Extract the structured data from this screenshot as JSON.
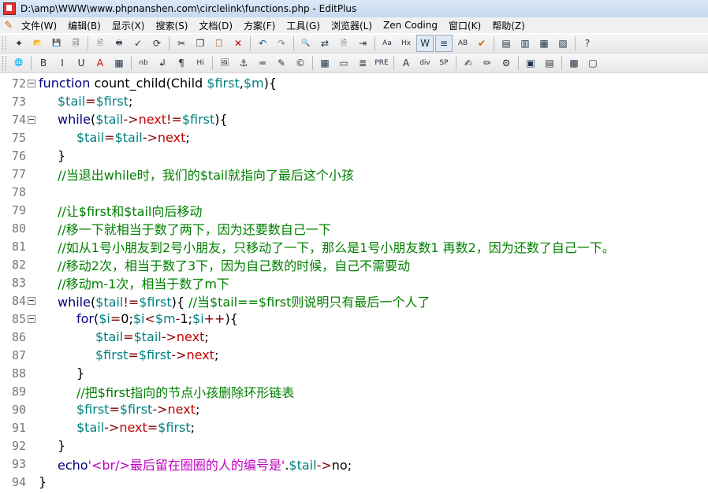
{
  "window": {
    "title": "D:\\amp\\WWW\\www.phpnanshen.com\\circlelink\\functions.php - EditPlus"
  },
  "menu": [
    "文件(W)",
    "编辑(B)",
    "显示(X)",
    "搜索(S)",
    "文档(D)",
    "方案(F)",
    "工具(G)",
    "浏览器(L)",
    "Zen Coding",
    "窗口(K)",
    "帮助(Z)"
  ],
  "toolbar1": [
    {
      "name": "new-file-icon",
      "glyph": "✦"
    },
    {
      "name": "open-file-icon",
      "glyph": "📂"
    },
    {
      "name": "save-icon",
      "glyph": "💾"
    },
    {
      "name": "save-all-icon",
      "glyph": "🗐"
    },
    {
      "sep": true
    },
    {
      "name": "print-preview-icon",
      "glyph": "🖹"
    },
    {
      "name": "print-icon",
      "glyph": "🖶"
    },
    {
      "name": "spell-check-icon",
      "glyph": "✓"
    },
    {
      "name": "refresh-icon",
      "glyph": "⟳"
    },
    {
      "sep": true
    },
    {
      "name": "cut-icon",
      "glyph": "✂"
    },
    {
      "name": "copy-icon",
      "glyph": "❐"
    },
    {
      "name": "paste-icon",
      "glyph": "📋"
    },
    {
      "name": "delete-icon",
      "glyph": "✕",
      "color": "#c00"
    },
    {
      "sep": true
    },
    {
      "name": "undo-icon",
      "glyph": "↶",
      "color": "#2255aa"
    },
    {
      "name": "redo-icon",
      "glyph": "↷",
      "color": "#888"
    },
    {
      "sep": true
    },
    {
      "name": "find-icon",
      "glyph": "🔍"
    },
    {
      "name": "replace-icon",
      "glyph": "⇄"
    },
    {
      "name": "find-in-files-icon",
      "glyph": "🗎"
    },
    {
      "name": "goto-line-icon",
      "glyph": "⇥"
    },
    {
      "sep": true
    },
    {
      "name": "font-icon",
      "glyph": "Aa"
    },
    {
      "name": "hex-icon",
      "glyph": "Hx"
    },
    {
      "name": "word-wrap-icon",
      "glyph": "W",
      "active": true
    },
    {
      "name": "line-number-icon",
      "glyph": "≡",
      "active": true
    },
    {
      "name": "ruler-icon",
      "glyph": "AB"
    },
    {
      "name": "check-icon",
      "glyph": "✔",
      "color": "#c60"
    },
    {
      "sep": true
    },
    {
      "name": "view-icon-1",
      "glyph": "▤"
    },
    {
      "name": "view-icon-2",
      "glyph": "▥"
    },
    {
      "name": "view-icon-3",
      "glyph": "▦"
    },
    {
      "name": "view-icon-4",
      "glyph": "▧"
    },
    {
      "sep": true
    },
    {
      "name": "help-icon",
      "glyph": "?"
    }
  ],
  "toolbar2": [
    {
      "name": "browser-icon",
      "glyph": "🌐"
    },
    {
      "sep": true
    },
    {
      "name": "bold-icon",
      "glyph": "B"
    },
    {
      "name": "italic-icon",
      "glyph": "I"
    },
    {
      "name": "underline-icon",
      "glyph": "U"
    },
    {
      "name": "font-color-icon",
      "glyph": "A",
      "color": "#c00"
    },
    {
      "name": "color-picker-icon",
      "glyph": "▦"
    },
    {
      "sep": true
    },
    {
      "name": "nbsp-icon",
      "glyph": "nb"
    },
    {
      "name": "line-break-icon",
      "glyph": "↲"
    },
    {
      "name": "paragraph-icon",
      "glyph": "¶"
    },
    {
      "name": "heading-icon",
      "glyph": "Hi"
    },
    {
      "sep": true
    },
    {
      "name": "image-icon",
      "glyph": "🖼"
    },
    {
      "name": "anchor-icon",
      "glyph": "⚓"
    },
    {
      "name": "hr-icon",
      "glyph": "═"
    },
    {
      "name": "comment-icon",
      "glyph": "✎"
    },
    {
      "name": "special-char-icon",
      "glyph": "©"
    },
    {
      "sep": true
    },
    {
      "name": "table-icon",
      "glyph": "▦"
    },
    {
      "name": "form-icon",
      "glyph": "▭"
    },
    {
      "name": "center-icon",
      "glyph": "≣"
    },
    {
      "name": "pre-icon",
      "glyph": "PRE"
    },
    {
      "sep": true
    },
    {
      "name": "style-icon",
      "glyph": "A"
    },
    {
      "name": "div-icon",
      "glyph": "div"
    },
    {
      "name": "span-icon",
      "glyph": "SP"
    },
    {
      "sep": true
    },
    {
      "name": "edit-tag-icon",
      "glyph": "✍"
    },
    {
      "name": "highlight-icon",
      "glyph": "✏"
    },
    {
      "name": "tools-icon",
      "glyph": "⚙"
    },
    {
      "sep": true
    },
    {
      "name": "window-icon-1",
      "glyph": "▣"
    },
    {
      "name": "window-icon-2",
      "glyph": "▤"
    },
    {
      "sep": true
    },
    {
      "name": "app-icon-1",
      "glyph": "▩"
    },
    {
      "name": "app-icon-2",
      "glyph": "▢"
    }
  ],
  "colors": {
    "keyword": "#000080",
    "variable": "#008080",
    "property": "#c00000",
    "operator": "#800000",
    "comment": "#008000",
    "string": "#c000c0",
    "plain": "#000000"
  },
  "code_lines": [
    {
      "num": "72",
      "fold": true,
      "indent": 0,
      "tokens": [
        [
          "k",
          "function "
        ],
        [
          "p",
          "count_child(Child "
        ],
        [
          "v",
          "$first"
        ],
        [
          "p",
          ","
        ],
        [
          "v",
          "$m"
        ],
        [
          "p",
          "){"
        ]
      ]
    },
    {
      "num": "73",
      "fold": false,
      "indent": 1,
      "tokens": [
        [
          "v",
          "$tail"
        ],
        [
          "o",
          "="
        ],
        [
          "v",
          "$first"
        ],
        [
          "p",
          ";"
        ]
      ]
    },
    {
      "num": "74",
      "fold": true,
      "indent": 1,
      "tokens": [
        [
          "k",
          "while"
        ],
        [
          "p",
          "("
        ],
        [
          "v",
          "$tail"
        ],
        [
          "o",
          "->"
        ],
        [
          "r",
          "next"
        ],
        [
          "o",
          "!="
        ],
        [
          "v",
          "$first"
        ],
        [
          "p",
          "){"
        ]
      ]
    },
    {
      "num": "75",
      "fold": false,
      "indent": 2,
      "tokens": [
        [
          "v",
          "$tail"
        ],
        [
          "o",
          "="
        ],
        [
          "v",
          "$tail"
        ],
        [
          "o",
          "->"
        ],
        [
          "r",
          "next"
        ],
        [
          "p",
          ";"
        ]
      ]
    },
    {
      "num": "76",
      "fold": false,
      "indent": 1,
      "tokens": [
        [
          "p",
          "}"
        ]
      ]
    },
    {
      "num": "77",
      "fold": false,
      "indent": 1,
      "tokens": [
        [
          "c",
          "//当退出while时，我们的$tail就指向了最后这个小孩"
        ]
      ]
    },
    {
      "num": "78",
      "fold": false,
      "indent": 0,
      "tokens": []
    },
    {
      "num": "79",
      "fold": false,
      "indent": 1,
      "tokens": [
        [
          "c",
          "//让$first和$tail向后移动"
        ]
      ]
    },
    {
      "num": "80",
      "fold": false,
      "indent": 1,
      "tokens": [
        [
          "c",
          "//移一下就相当于数了两下，因为还要数自己一下"
        ]
      ]
    },
    {
      "num": "81",
      "fold": false,
      "indent": 1,
      "tokens": [
        [
          "c",
          "//如从1号小朋友到2号小朋友，只移动了一下，那么是1号小朋友数1 再数2，因为还数了自己一下。"
        ]
      ]
    },
    {
      "num": "82",
      "fold": false,
      "indent": 1,
      "tokens": [
        [
          "c",
          "//移动2次，相当于数了3下，因为自己数的时候，自己不需要动"
        ]
      ]
    },
    {
      "num": "83",
      "fold": false,
      "indent": 1,
      "tokens": [
        [
          "c",
          "//移动m-1次，相当于数了m下"
        ]
      ]
    },
    {
      "num": "84",
      "fold": true,
      "indent": 1,
      "tokens": [
        [
          "k",
          "while"
        ],
        [
          "p",
          "("
        ],
        [
          "v",
          "$tail"
        ],
        [
          "o",
          "!="
        ],
        [
          "v",
          "$first"
        ],
        [
          "p",
          "){ "
        ],
        [
          "c",
          "//当$tail==$first则说明只有最后一个人了"
        ]
      ]
    },
    {
      "num": "85",
      "fold": true,
      "indent": 2,
      "tokens": [
        [
          "k",
          "for"
        ],
        [
          "p",
          "("
        ],
        [
          "v",
          "$i"
        ],
        [
          "o",
          "="
        ],
        [
          "p",
          "0;"
        ],
        [
          "v",
          "$i"
        ],
        [
          "o",
          "<"
        ],
        [
          "v",
          "$m"
        ],
        [
          "o",
          "-"
        ],
        [
          "p",
          "1;"
        ],
        [
          "v",
          "$i"
        ],
        [
          "o",
          "++"
        ],
        [
          "p",
          "){"
        ]
      ]
    },
    {
      "num": "86",
      "fold": false,
      "indent": 3,
      "tokens": [
        [
          "v",
          "$tail"
        ],
        [
          "o",
          "="
        ],
        [
          "v",
          "$tail"
        ],
        [
          "o",
          "->"
        ],
        [
          "r",
          "next"
        ],
        [
          "p",
          ";"
        ]
      ]
    },
    {
      "num": "87",
      "fold": false,
      "indent": 3,
      "tokens": [
        [
          "v",
          "$first"
        ],
        [
          "o",
          "="
        ],
        [
          "v",
          "$first"
        ],
        [
          "o",
          "->"
        ],
        [
          "r",
          "next"
        ],
        [
          "p",
          ";"
        ]
      ]
    },
    {
      "num": "88",
      "fold": false,
      "indent": 2,
      "tokens": [
        [
          "p",
          "}"
        ]
      ]
    },
    {
      "num": "89",
      "fold": false,
      "indent": 2,
      "tokens": [
        [
          "c",
          "//把$first指向的节点小孩删除环形链表"
        ]
      ]
    },
    {
      "num": "90",
      "fold": false,
      "indent": 2,
      "tokens": [
        [
          "v",
          "$first"
        ],
        [
          "o",
          "="
        ],
        [
          "v",
          "$first"
        ],
        [
          "o",
          "->"
        ],
        [
          "r",
          "next"
        ],
        [
          "p",
          ";"
        ]
      ]
    },
    {
      "num": "91",
      "fold": false,
      "indent": 2,
      "tokens": [
        [
          "v",
          "$tail"
        ],
        [
          "o",
          "->"
        ],
        [
          "r",
          "next"
        ],
        [
          "o",
          "="
        ],
        [
          "v",
          "$first"
        ],
        [
          "p",
          ";"
        ]
      ]
    },
    {
      "num": "92",
      "fold": false,
      "indent": 1,
      "tokens": [
        [
          "p",
          "}"
        ]
      ]
    },
    {
      "num": "93",
      "fold": false,
      "indent": 1,
      "tokens": [
        [
          "k",
          "echo"
        ],
        [
          "s",
          "'<br/>最后留在圈圈的人的编号是'"
        ],
        [
          "p",
          "."
        ],
        [
          "v",
          "$tail"
        ],
        [
          "o",
          "->"
        ],
        [
          "p",
          "no;"
        ]
      ]
    },
    {
      "num": "94",
      "fold": false,
      "indent": 0,
      "tokens": [
        [
          "p",
          "}"
        ]
      ]
    }
  ]
}
